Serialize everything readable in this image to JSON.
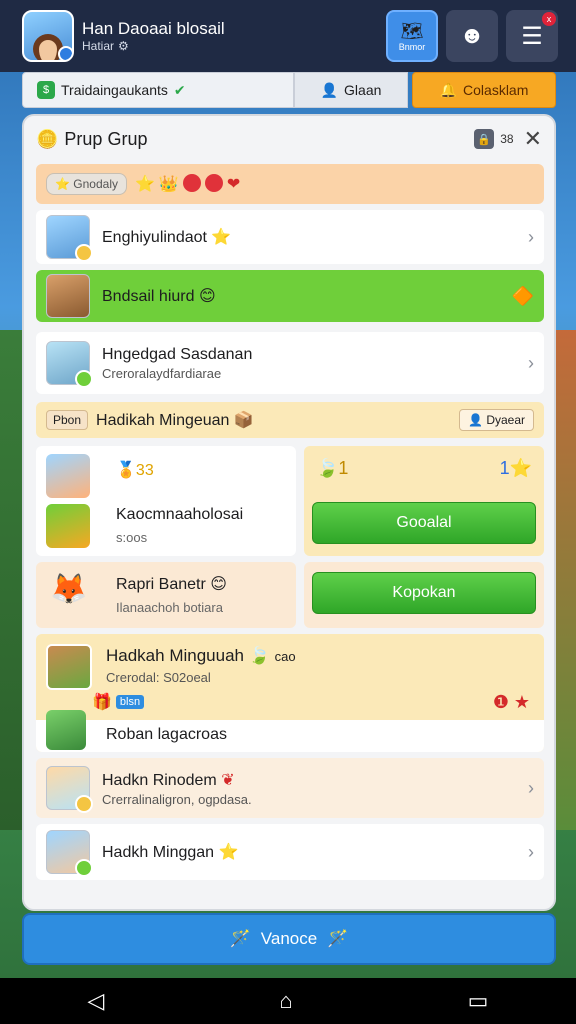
{
  "profile": {
    "name": "Han Daoaai blosail",
    "subtitle": "Hatiar"
  },
  "top_buttons": {
    "map_label": "Bnmor",
    "menu_badge": "x"
  },
  "tabs": [
    {
      "label": "Traidaingaukants"
    },
    {
      "label": "Glaan"
    },
    {
      "label": "Colasklam"
    }
  ],
  "panel": {
    "title": "Prup Grup",
    "count": "38",
    "filter_chip": "Gnodaly",
    "rows": [
      {
        "main": "Enghiyulindaot",
        "sub": ""
      },
      {
        "main": "Bndsail hiurd",
        "sub": ""
      },
      {
        "main": "Hngedgad Sasdanan",
        "sub": "Creroralaydfardiarae"
      }
    ],
    "section": {
      "chip": "Pbon",
      "title": "Hadikah Mingeuan",
      "right_label": "Dyaear"
    },
    "card_left1": {
      "score": "33",
      "main": "Kaocmnaaholosai",
      "sub": "s:oos"
    },
    "card_right1": {
      "left_num": "1",
      "right_num": "1",
      "button": "Gooalal"
    },
    "card_left2": {
      "main": "Rapri Banetr",
      "sub": "Ilanaachoh botiara"
    },
    "card_right2": {
      "button": "Kopokan"
    },
    "big_row": {
      "main": "Hadkah Minguuah",
      "tag": "cao",
      "sub": "Crerodal: S02oeal",
      "badge": "blsn",
      "bottom": "Roban lagacroas"
    },
    "row4": {
      "main": "Hadkn Rinodem",
      "sub": "Crerralinaligron, ogpdasa."
    },
    "row5": {
      "main": "Hadkh Minggan",
      "sub": ""
    }
  },
  "cta": {
    "label": "Vanoce"
  },
  "colors": {
    "accent": "#2e8de0",
    "green": "#6fcf3a",
    "orange": "#f7a823",
    "topbar": "#1f2a44"
  }
}
